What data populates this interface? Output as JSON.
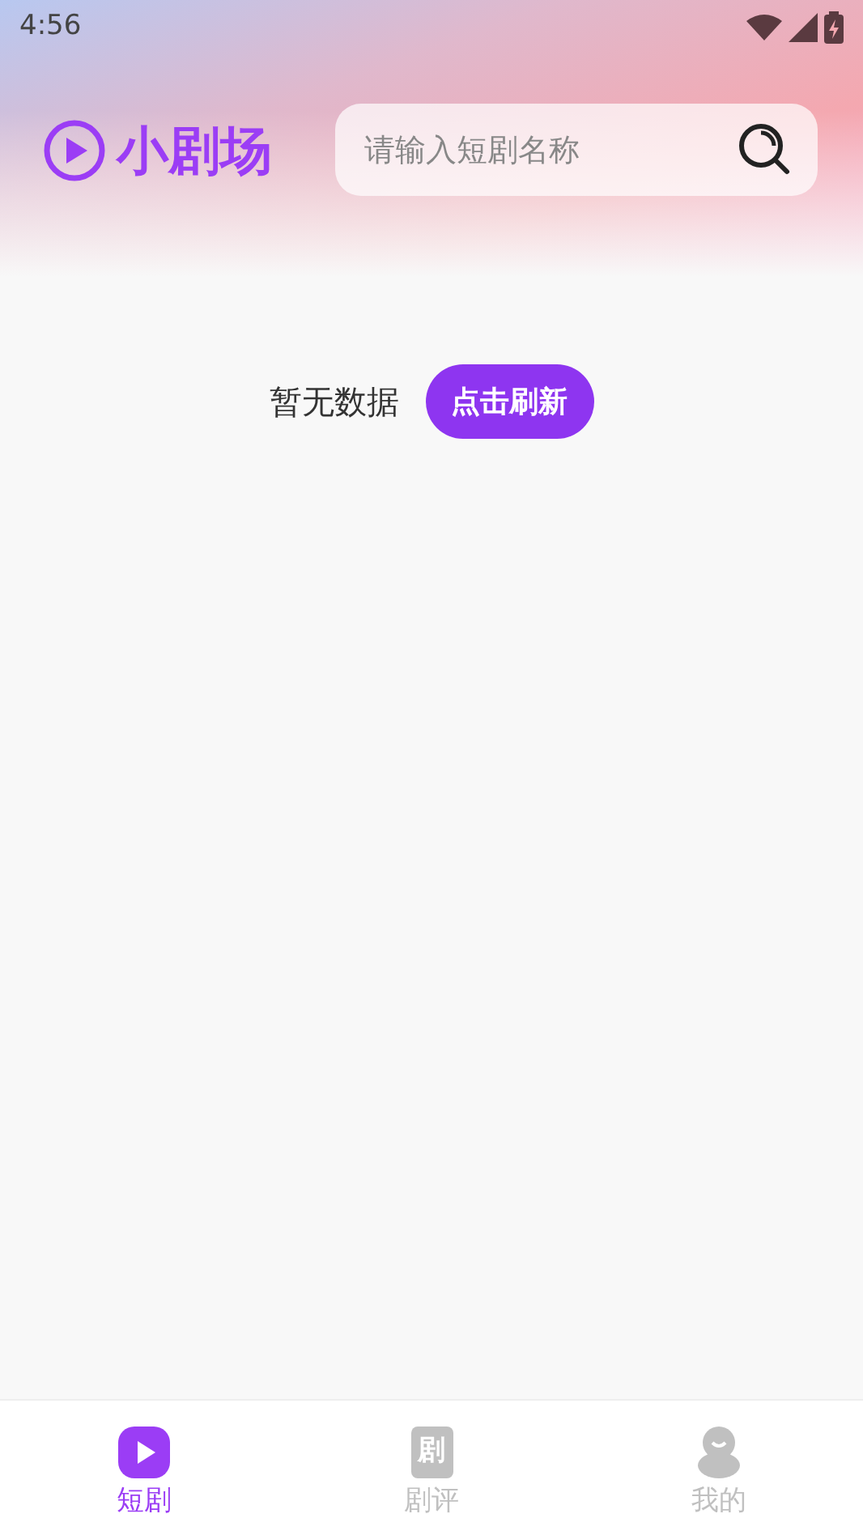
{
  "status_bar": {
    "time": "4:56"
  },
  "header": {
    "logo_text": "小剧场",
    "search": {
      "placeholder": "请输入短剧名称"
    }
  },
  "empty_state": {
    "message": "暂无数据",
    "button": "点击刷新"
  },
  "tab_bar": [
    {
      "kind": "play",
      "label": "短剧",
      "selected": true
    },
    {
      "kind": "book",
      "label": "剧评",
      "icon_text": "剧",
      "selected": false
    },
    {
      "kind": "person",
      "label": "我的",
      "selected": false
    }
  ]
}
